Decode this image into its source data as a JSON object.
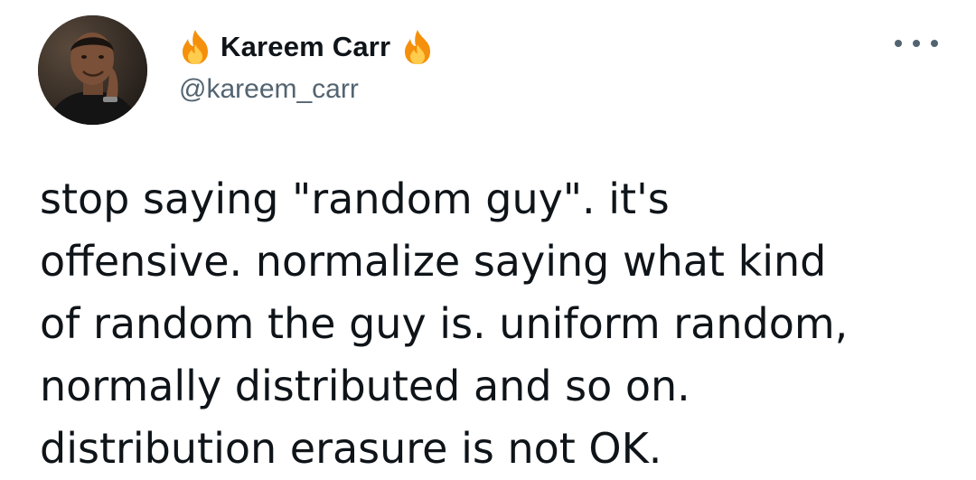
{
  "author": {
    "display_name": "Kareem Carr",
    "handle": "@kareem_carr",
    "name_prefix_icon": "fire-emoji-icon",
    "name_suffix_icon": "fire-emoji-icon",
    "avatar": "profile-photo"
  },
  "menu": {
    "icon": "more-options-icon"
  },
  "tweet": {
    "lines": [
      "stop saying \"random guy\". it's",
      "offensive. normalize saying what kind",
      "of random the guy is. uniform random,",
      "normally distributed and so on.",
      "distribution erasure is not OK."
    ]
  },
  "colors": {
    "text": "#0f1419",
    "secondary_text": "#536471",
    "background": "#ffffff"
  }
}
